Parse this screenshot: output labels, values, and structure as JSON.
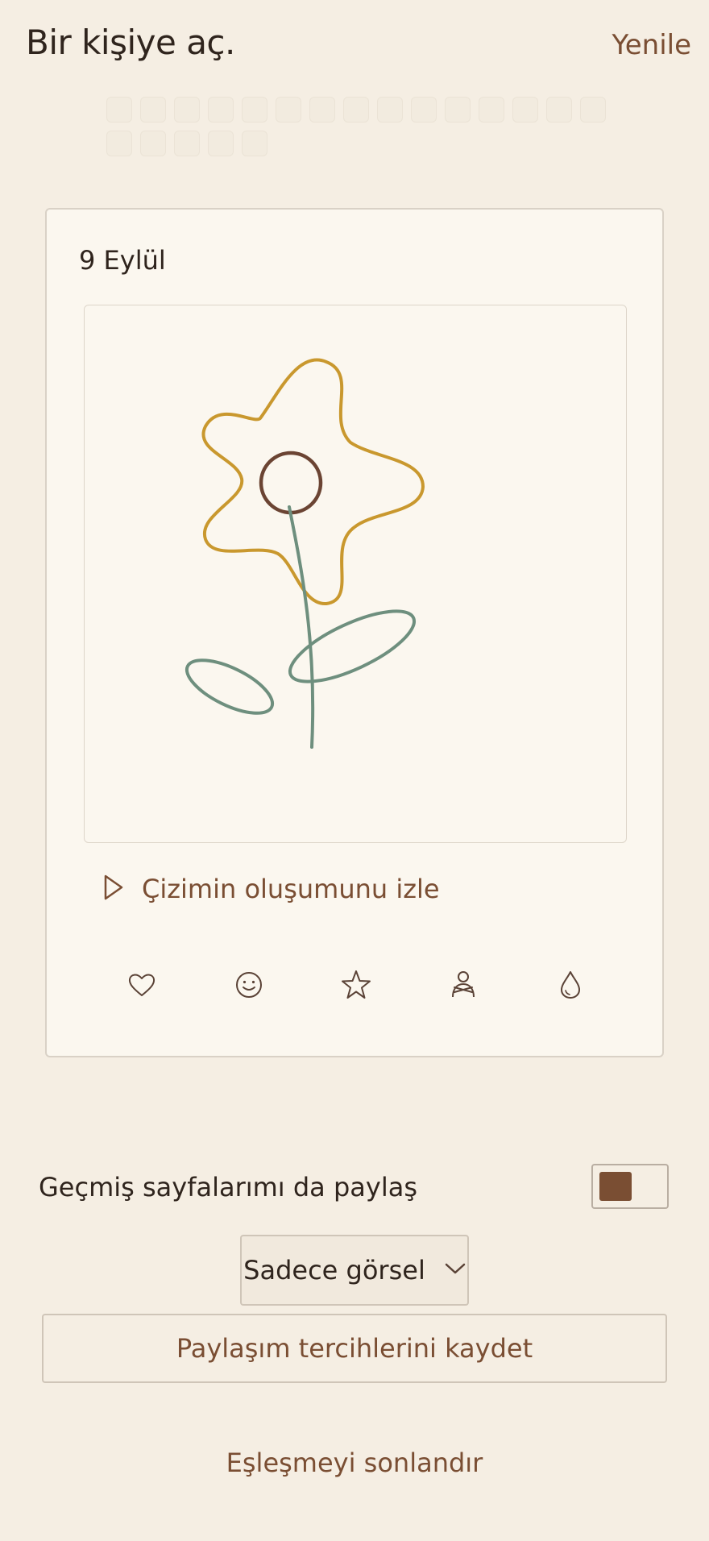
{
  "header": {
    "title": "Bir kişiye aç.",
    "refresh_label": "Yenile"
  },
  "day_grid": {
    "cell_count": 20
  },
  "card": {
    "date": "9 Eylül",
    "replay_label": "Çizimin oluşumunu izle",
    "reactions": [
      {
        "icon": "heart-icon"
      },
      {
        "icon": "smile-icon"
      },
      {
        "icon": "star-icon"
      },
      {
        "icon": "hug-icon"
      },
      {
        "icon": "tear-drop-icon"
      }
    ],
    "drawing": {
      "subject": "flower",
      "colors": {
        "petals": "#C9982E",
        "center": "#6B4433",
        "stem": "#6E8F7E"
      }
    }
  },
  "share_settings": {
    "past_pages_label": "Geçmiş sayfalarımı da paylaş",
    "past_pages_enabled": true,
    "visibility_selected": "Sadece görsel",
    "save_label": "Paylaşım tercihlerini kaydet"
  },
  "footer": {
    "end_match_label": "Eşleşmeyi sonlandır"
  },
  "colors": {
    "background": "#F5EEE3",
    "card": "#FBF7EF",
    "accent_brown": "#7A4E33",
    "text": "#2F241D"
  }
}
